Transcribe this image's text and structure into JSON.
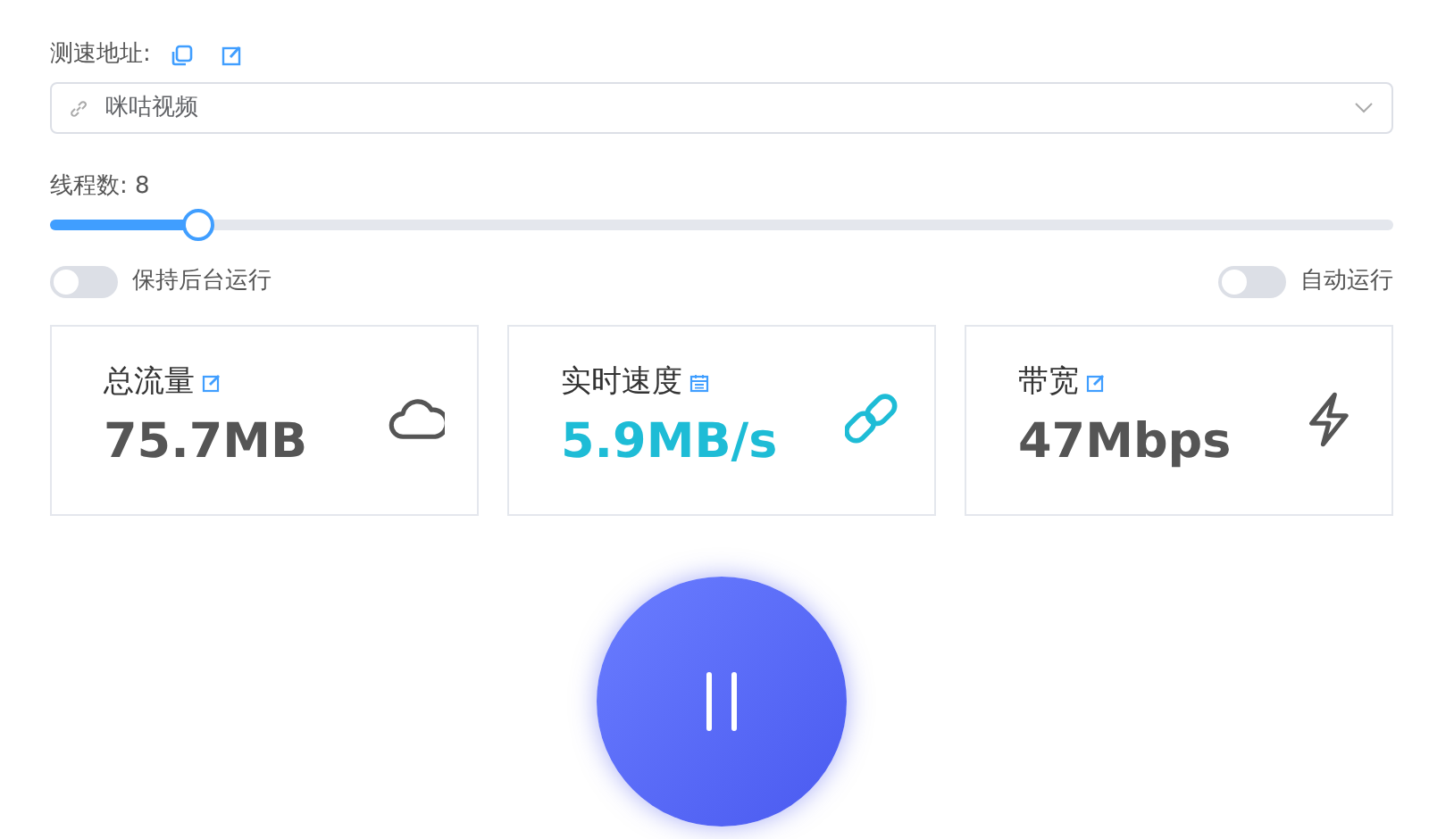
{
  "address": {
    "label": "测速地址:",
    "value": "咪咕视频"
  },
  "threads": {
    "label": "线程数: 8",
    "level": 0.11
  },
  "switches": [
    {
      "label": "保持后台运行",
      "on": false
    },
    {
      "label": "自动运行",
      "on": false
    }
  ],
  "stats": [
    {
      "title": "总流量",
      "value": "75.7MB",
      "color": "#555555"
    },
    {
      "title": "实时速度",
      "value": "5.9MB/s",
      "color": "#1ebcd6"
    },
    {
      "title": "带宽",
      "value": "47Mbps",
      "color": "#555555"
    }
  ]
}
